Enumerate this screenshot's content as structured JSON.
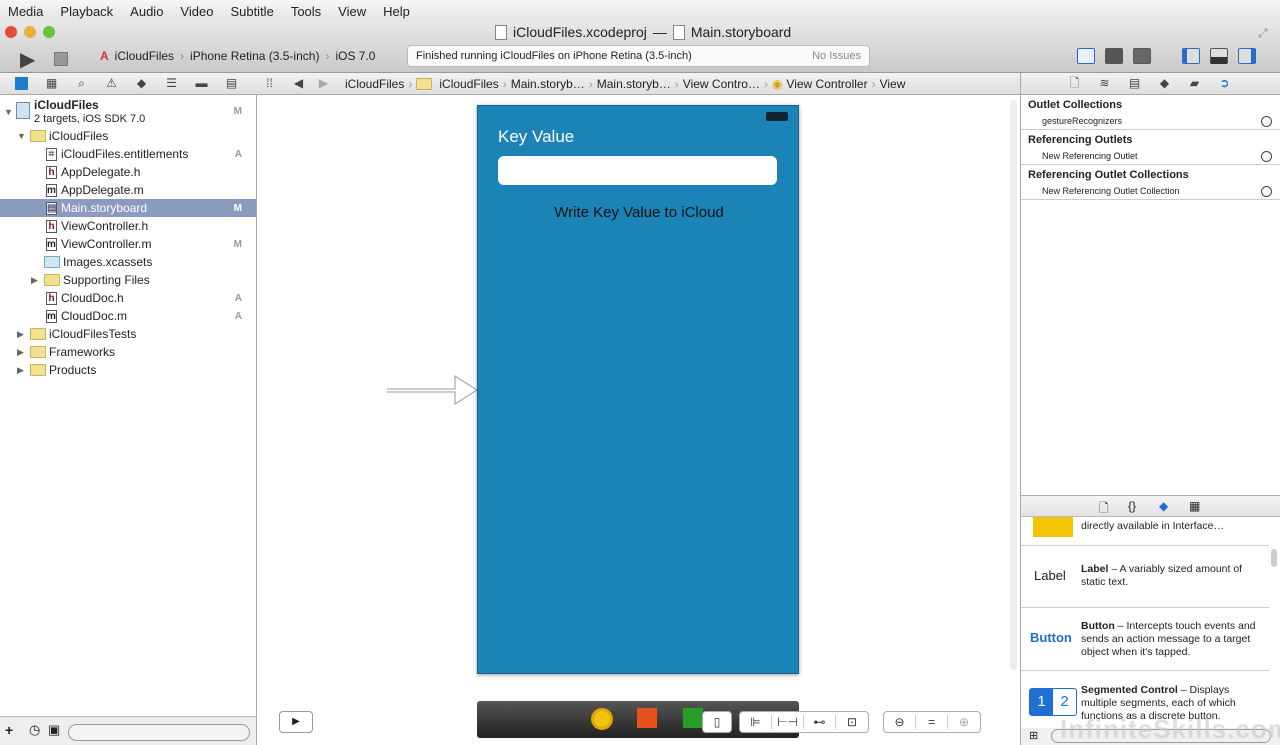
{
  "menu": [
    "Media",
    "Playback",
    "Audio",
    "Video",
    "Subtitle",
    "Tools",
    "View",
    "Help"
  ],
  "window": {
    "project": "iCloudFiles.xcodeproj",
    "separator": "—",
    "file": "Main.storyboard"
  },
  "toolbar": {
    "scheme": "iCloudFiles",
    "device": "iPhone Retina (3.5-inch)",
    "os": "iOS 7.0",
    "status": "Finished running iCloudFiles on iPhone Retina (3.5-inch)",
    "issues": "No Issues"
  },
  "breadcrumbs": [
    "iCloudFiles",
    "iCloudFiles",
    "Main.storyb…",
    "Main.storyb…",
    "View Contro…",
    "View Controller",
    "View"
  ],
  "navigator": {
    "project": {
      "name": "iCloudFiles",
      "subtitle": "2 targets, iOS SDK 7.0",
      "badge": "M"
    },
    "items": [
      {
        "label": "iCloudFiles",
        "kind": "folder",
        "badge": ""
      },
      {
        "label": "iCloudFiles.entitlements",
        "kind": "entitlements",
        "badge": "A"
      },
      {
        "label": "AppDelegate.h",
        "kind": "h",
        "badge": ""
      },
      {
        "label": "AppDelegate.m",
        "kind": "m",
        "badge": ""
      },
      {
        "label": "Main.storyboard",
        "kind": "storyboard",
        "badge": "M"
      },
      {
        "label": "ViewController.h",
        "kind": "h",
        "badge": ""
      },
      {
        "label": "ViewController.m",
        "kind": "m",
        "badge": "M"
      },
      {
        "label": "Images.xcassets",
        "kind": "assets",
        "badge": ""
      },
      {
        "label": "Supporting Files",
        "kind": "folder",
        "badge": ""
      },
      {
        "label": "CloudDoc.h",
        "kind": "h",
        "badge": "A"
      },
      {
        "label": "CloudDoc.m",
        "kind": "m",
        "badge": "A"
      },
      {
        "label": "iCloudFilesTests",
        "kind": "folder",
        "badge": ""
      },
      {
        "label": "Frameworks",
        "kind": "folder",
        "badge": ""
      },
      {
        "label": "Products",
        "kind": "folder",
        "badge": ""
      }
    ]
  },
  "phone": {
    "label": "Key Value",
    "input_value": "",
    "button": "Write Key Value to iCloud",
    "background": "#1b83b6"
  },
  "inspector": {
    "sections": [
      {
        "title": "Outlet Collections",
        "item": "gestureRecognizers"
      },
      {
        "title": "Referencing Outlets",
        "item": "New Referencing Outlet"
      },
      {
        "title": "Referencing Outlet Collections",
        "item": "New Referencing Outlet Collection"
      }
    ]
  },
  "library": [
    {
      "icon": "",
      "name": "",
      "desc": "directly available in Interface…"
    },
    {
      "icon": "Label",
      "name": "Label",
      "desc": " – A variably sized amount of static text."
    },
    {
      "icon": "Button",
      "name": "Button",
      "desc": " – Intercepts touch events and sends an action message to a target object when it's tapped."
    },
    {
      "icon": "",
      "name": "Segmented Control",
      "desc": " – Displays multiple segments, each of which functions as a discrete button.",
      "seg1": "1",
      "seg2": "2"
    }
  ],
  "watermark": "InfiniteSkills.com"
}
